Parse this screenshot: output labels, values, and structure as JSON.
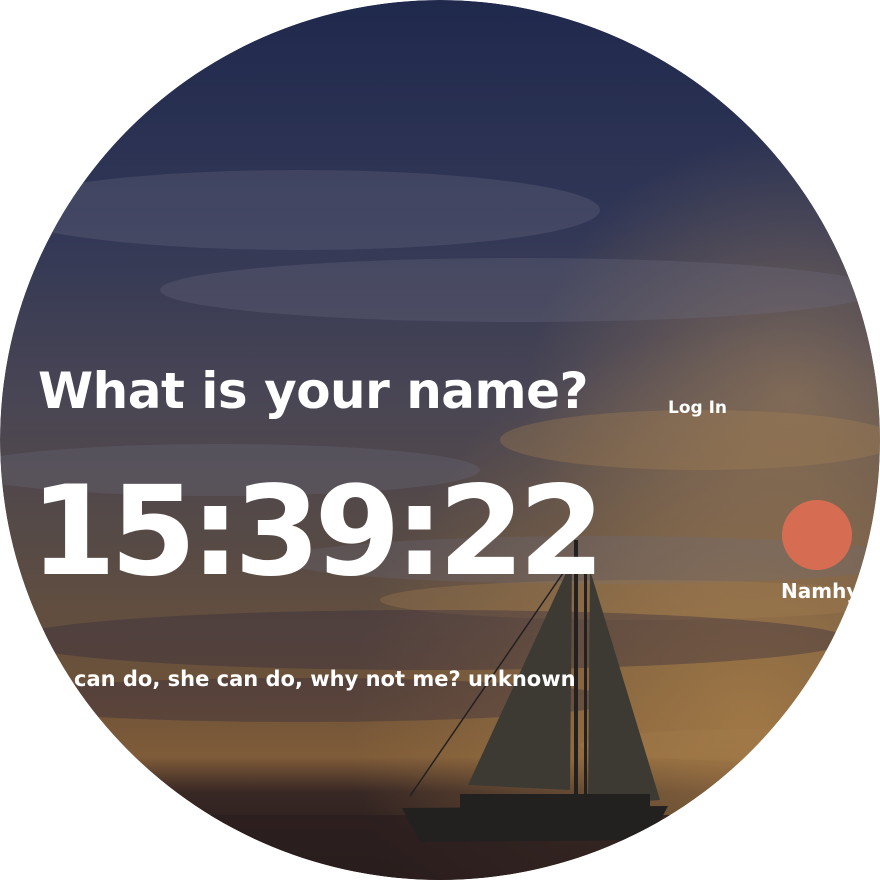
{
  "prompt": {
    "question": "What is your name?",
    "login_label": "Log In"
  },
  "clock": {
    "time": "15:39:22"
  },
  "user": {
    "name": "Namhya",
    "avatar_color": "#d66d52"
  },
  "quote": {
    "text": "can do, she can do, why not me? unknown"
  },
  "background": {
    "scene": "sailboat-at-sunset",
    "sky_top_color": "#2a3560",
    "horizon_color": "#c98d4f",
    "water_color": "#3a2a28"
  }
}
